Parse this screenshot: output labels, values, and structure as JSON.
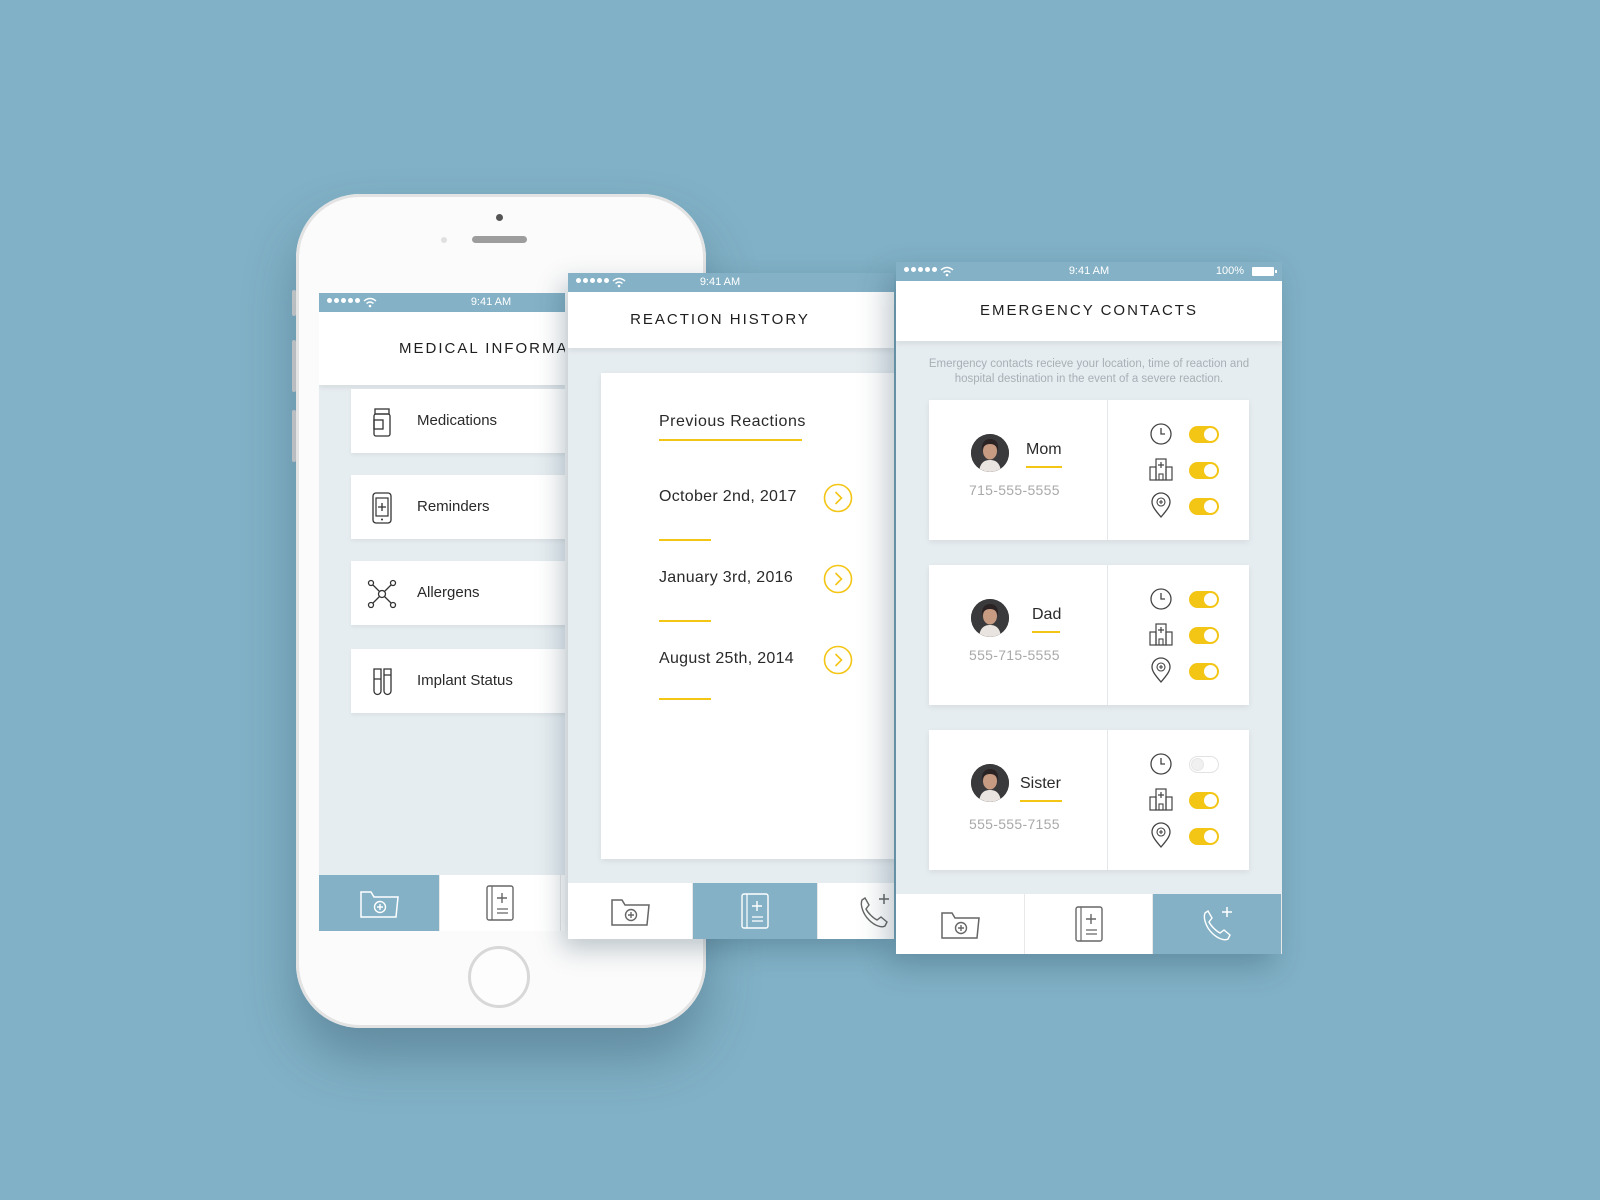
{
  "status": {
    "time": "9:41 AM",
    "battery": "100%"
  },
  "medical": {
    "title": "MEDICAL INFORMAT",
    "items": [
      {
        "label": "Medications",
        "icon": "pill-bottle-icon"
      },
      {
        "label": "Reminders",
        "icon": "phone-reminder-icon"
      },
      {
        "label": "Allergens",
        "icon": "molecule-icon"
      },
      {
        "label": "Implant Status",
        "icon": "test-tubes-icon"
      }
    ],
    "active_tab": 0
  },
  "reaction": {
    "title": "REACTION HISTORY",
    "subtitle": "Previous Reactions",
    "dates": [
      "October 2nd, 2017",
      "January 3rd, 2016",
      "August 25th, 2014"
    ],
    "active_tab": 1
  },
  "emergency": {
    "title": "EMERGENCY CONTACTS",
    "description": "Emergency contacts recieve your location, time of reaction and hospital destination in the event of a severe reaction.",
    "contacts": [
      {
        "name": "Mom",
        "phone": "715-555-5555",
        "time_on": true,
        "hospital_on": true,
        "location_on": true
      },
      {
        "name": "Dad",
        "phone": "555-715-5555",
        "time_on": true,
        "hospital_on": true,
        "location_on": true
      },
      {
        "name": "Sister",
        "phone": "555-555-7155",
        "time_on": false,
        "hospital_on": true,
        "location_on": true
      }
    ],
    "active_tab": 2
  },
  "tabs": [
    "medical-folder-icon",
    "medical-book-icon",
    "phone-plus-icon"
  ],
  "colors": {
    "background": "#81b1c6",
    "accent": "#84b1c6",
    "highlight": "#f3c515"
  }
}
